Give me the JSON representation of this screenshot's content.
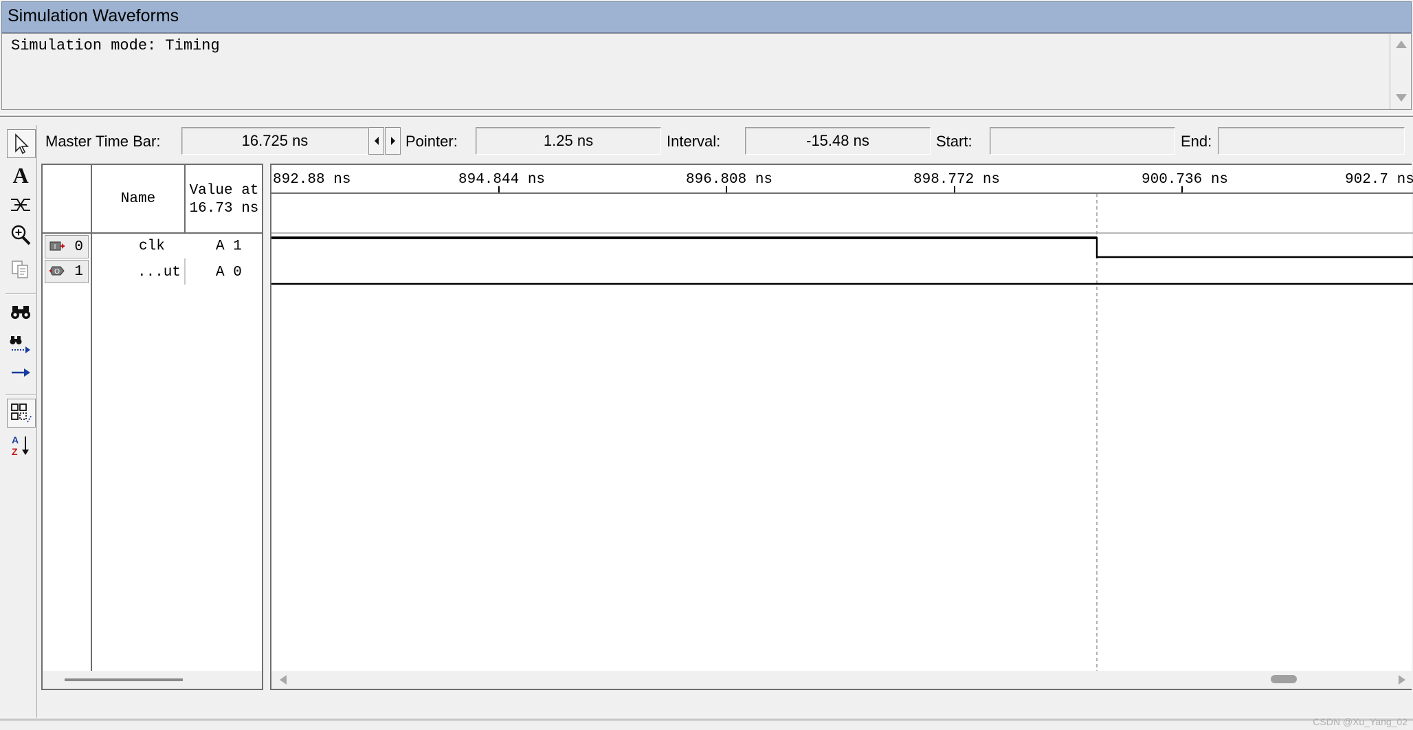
{
  "window": {
    "title": "Simulation Waveforms"
  },
  "messages": {
    "text": "Simulation mode: Timing"
  },
  "toolbar": {
    "tools": [
      {
        "name": "selection-tool",
        "icon": "arrow-pointer-icon"
      },
      {
        "name": "text-tool",
        "icon": "text-A-icon"
      },
      {
        "name": "waveform-editing-tool",
        "icon": "waveform-edit-icon"
      },
      {
        "name": "zoom-tool",
        "icon": "zoom-icon"
      },
      {
        "name": "copy-tool",
        "icon": "copy-icon"
      },
      {
        "name": "find-tool",
        "icon": "binoculars-icon"
      },
      {
        "name": "find-next-tool",
        "icon": "find-next-icon"
      },
      {
        "name": "next-transition-tool",
        "icon": "arrow-right-icon"
      },
      {
        "name": "snap-to-grid-tool",
        "icon": "grid-icon"
      },
      {
        "name": "sort-tool",
        "icon": "sort-az-icon"
      }
    ]
  },
  "timebar": {
    "master_label": "Master Time Bar:",
    "master_value": "16.725 ns",
    "pointer_label": "Pointer:",
    "pointer_value": "1.25 ns",
    "interval_label": "Interval:",
    "interval_value": "-15.48 ns",
    "start_label": "Start:",
    "start_value": "",
    "end_label": "End:",
    "end_value": ""
  },
  "signals": {
    "header_name": "Name",
    "header_value_line1": "Value at",
    "header_value_line2": "16.73 ns",
    "rows": [
      {
        "index": "0",
        "name": "clk",
        "value": "A 1",
        "pin": "input-pin-icon"
      },
      {
        "index": "1",
        "name": "...ut",
        "value": "A 0",
        "pin": "output-pin-icon"
      }
    ]
  },
  "timeline": {
    "ticks": [
      "892.88 ns",
      "894.844 ns",
      "896.808 ns",
      "898.772 ns",
      "900.736 ns",
      "902.7 ns"
    ]
  },
  "waveforms": [
    {
      "signal": "clk",
      "initial_level": 1,
      "transition_at_ns": 899.95,
      "final_level": 0
    },
    {
      "signal": "...ut",
      "level": 0
    }
  ],
  "watermark": "CSDN @Xu_Yang_02"
}
